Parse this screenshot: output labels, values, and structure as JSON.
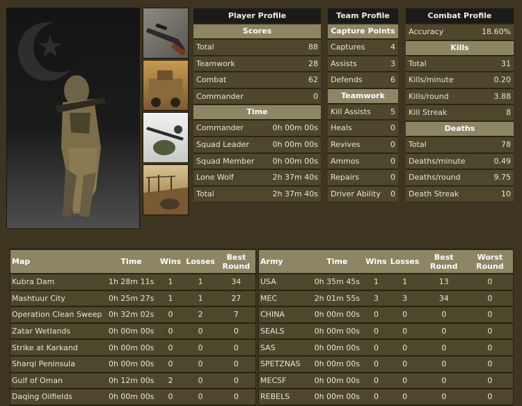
{
  "player_profile": {
    "title": "Player Profile",
    "scores_header": "Scores",
    "scores": [
      {
        "label": "Total",
        "value": "88"
      },
      {
        "label": "Teamwork",
        "value": "28"
      },
      {
        "label": "Combat",
        "value": "62"
      },
      {
        "label": "Commander",
        "value": "0"
      }
    ],
    "time_header": "Time",
    "time": [
      {
        "label": "Commander",
        "value": "0h 00m 00s"
      },
      {
        "label": "Squad Leader",
        "value": "0h 00m 00s"
      },
      {
        "label": "Squad Member",
        "value": "0h 00m 00s"
      },
      {
        "label": "Lone Wolf",
        "value": "2h 37m 40s"
      },
      {
        "label": "Total",
        "value": "2h 37m 40s"
      }
    ]
  },
  "team_profile": {
    "title": "Team Profile",
    "capture_header": "Capture Points",
    "capture": [
      {
        "label": "Captures",
        "value": "4"
      },
      {
        "label": "Assists",
        "value": "3"
      },
      {
        "label": "Defends",
        "value": "6"
      }
    ],
    "teamwork_header": "Teamwork",
    "teamwork": [
      {
        "label": "Kill Assists",
        "value": "5"
      },
      {
        "label": "Heals",
        "value": "0"
      },
      {
        "label": "Revives",
        "value": "0"
      },
      {
        "label": "Ammos",
        "value": "0"
      },
      {
        "label": "Repairs",
        "value": "0"
      },
      {
        "label": "Driver Ability",
        "value": "0"
      }
    ]
  },
  "combat_profile": {
    "title": "Combat Profile",
    "accuracy": {
      "label": "Accuracy",
      "value": "18.60%"
    },
    "kills_header": "Kills",
    "kills": [
      {
        "label": "Total",
        "value": "31"
      },
      {
        "label": "Kills/minute",
        "value": "0.20"
      },
      {
        "label": "Kills/round",
        "value": "3.88"
      },
      {
        "label": "Kill Streak",
        "value": "8"
      }
    ],
    "deaths_header": "Deaths",
    "deaths": [
      {
        "label": "Total",
        "value": "78"
      },
      {
        "label": "Deaths/minute",
        "value": "0.49"
      },
      {
        "label": "Deaths/round",
        "value": "9.75"
      },
      {
        "label": "Death Streak",
        "value": "10"
      }
    ]
  },
  "maps_table": {
    "headers": [
      "Map",
      "Time",
      "Wins",
      "Losses",
      "Best Round"
    ],
    "rows": [
      [
        "Kubra Dam",
        "1h 28m 11s",
        "1",
        "1",
        "34"
      ],
      [
        "Mashtuur City",
        "0h 25m 27s",
        "1",
        "1",
        "27"
      ],
      [
        "Operation Clean Sweep",
        "0h 32m 02s",
        "0",
        "2",
        "7"
      ],
      [
        "Zatar Wetlands",
        "0h 00m 00s",
        "0",
        "0",
        "0"
      ],
      [
        "Strike at Karkand",
        "0h 00m 00s",
        "0",
        "0",
        "0"
      ],
      [
        "Sharqi Peninsula",
        "0h 00m 00s",
        "0",
        "0",
        "0"
      ],
      [
        "Gulf of Oman",
        "0h 12m 00s",
        "2",
        "0",
        "0"
      ],
      [
        "Daqing Oilfields",
        "0h 00m 00s",
        "0",
        "0",
        "0"
      ]
    ]
  },
  "army_table": {
    "headers": [
      "Army",
      "Time",
      "Wins",
      "Losses",
      "Best Round",
      "Worst Round"
    ],
    "rows": [
      [
        "USA",
        "0h 35m 45s",
        "1",
        "1",
        "13",
        "0"
      ],
      [
        "MEC",
        "2h 01m 55s",
        "3",
        "3",
        "34",
        "0"
      ],
      [
        "CHINA",
        "0h 00m 00s",
        "0",
        "0",
        "0",
        "0"
      ],
      [
        "SEALS",
        "0h 00m 00s",
        "0",
        "0",
        "0",
        "0"
      ],
      [
        "SAS",
        "0h 00m 00s",
        "0",
        "0",
        "0",
        "0"
      ],
      [
        "SPETZNAS",
        "0h 00m 00s",
        "0",
        "0",
        "0",
        "0"
      ],
      [
        "MECSF",
        "0h 00m 00s",
        "0",
        "0",
        "0",
        "0"
      ],
      [
        "REBELS",
        "0h 00m 00s",
        "0",
        "0",
        "0",
        "0"
      ]
    ]
  },
  "icons": {
    "faction_emblem": "crescent-star-icon",
    "thumb_1": "sniper-rifle-icon",
    "thumb_2": "armored-vehicle-icon",
    "thumb_3": "helmet-icon",
    "thumb_4": "map-scene-icon"
  },
  "colors": {
    "background": "#3e3520",
    "header": "#1a1a1a",
    "section": "#8c8664",
    "row": "#4f472c"
  }
}
